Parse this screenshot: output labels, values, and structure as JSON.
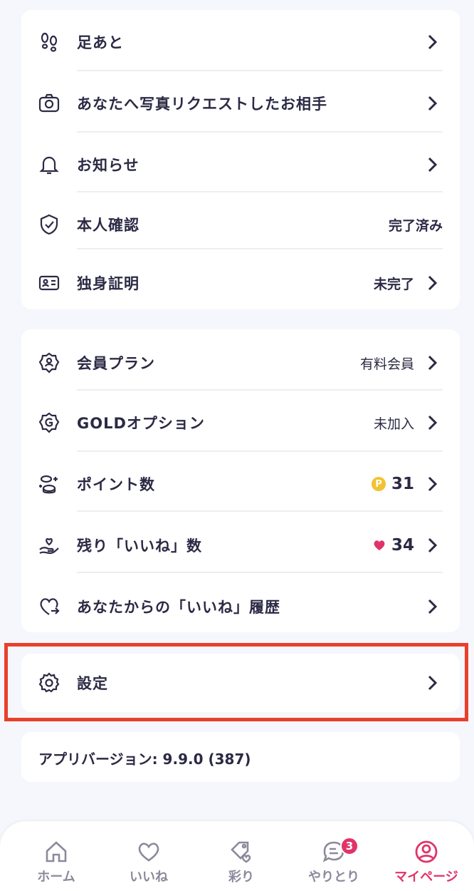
{
  "section1": [
    {
      "icon": "footprints-icon",
      "label": "足あと"
    },
    {
      "icon": "camera-icon",
      "label": "あなたへ写真リクエストしたお相手"
    },
    {
      "icon": "bell-icon",
      "label": "お知らせ"
    },
    {
      "icon": "shield-check-icon",
      "label": "本人確認",
      "status": "完了済み"
    },
    {
      "icon": "id-card-icon",
      "label": "独身証明",
      "status": "未完了"
    }
  ],
  "section2": [
    {
      "icon": "member-badge-icon",
      "label": "会員プラン",
      "value": "有料会員"
    },
    {
      "icon": "gold-badge-icon",
      "label": "GOLDオプション",
      "value": "未加入"
    },
    {
      "icon": "coins-icon",
      "label": "ポイント数",
      "value": "31",
      "value_icon": "P"
    },
    {
      "icon": "hand-heart-icon",
      "label": "残り「いいね」数",
      "value": "34"
    },
    {
      "icon": "heart-arrow-icon",
      "label": "あなたからの「いいね」履歴"
    }
  ],
  "settings": {
    "icon": "gear-icon",
    "label": "設定"
  },
  "version": {
    "text": "アプリバージョン: 9.9.0 (387)"
  },
  "tabs": [
    {
      "icon": "home-icon",
      "label": "ホーム"
    },
    {
      "icon": "heart-icon",
      "label": "いいね"
    },
    {
      "icon": "tag-heart-icon",
      "label": "彩り"
    },
    {
      "icon": "chat-icon",
      "label": "やりとり",
      "badge": "3"
    },
    {
      "icon": "user-circle-icon",
      "label": "マイページ",
      "active": true
    }
  ],
  "colors": {
    "accent": "#e03469",
    "ok": "#4cb85a",
    "ng": "#e04a35",
    "highlight": "#e8402c",
    "text": "#2b2a44"
  }
}
